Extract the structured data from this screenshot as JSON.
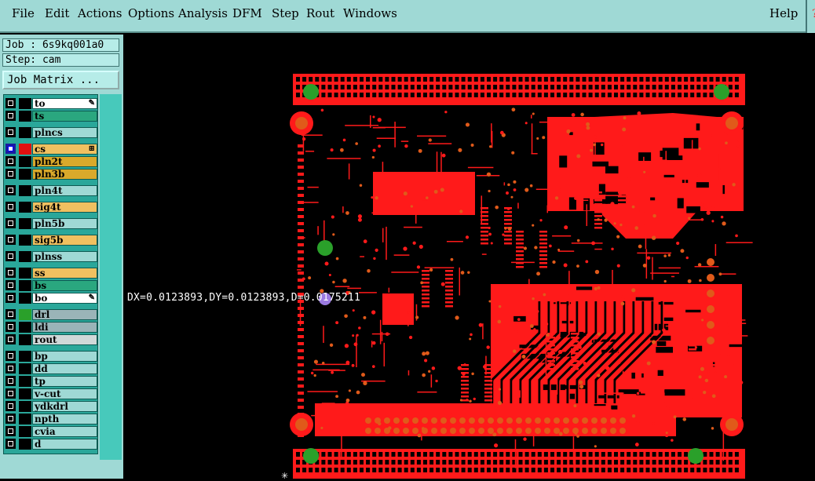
{
  "menu": {
    "items": [
      "File",
      "Edit",
      "Actions",
      "Options",
      "Analysis",
      "DFM",
      "Step",
      "Rout",
      "Windows"
    ],
    "help": "Help",
    "edge_glyph": "?"
  },
  "panel": {
    "job": "Job : 6s9kq001a0",
    "step": "Step: cam",
    "job_matrix": "Job Matrix ..."
  },
  "layers": [
    {
      "name": "to",
      "color": "#ffffff",
      "swatch": "#000000",
      "mark": "edit"
    },
    {
      "name": "ts",
      "color": "#2aa77f",
      "swatch": "#000000"
    },
    {
      "name": "plncs",
      "color": "#9fd9d5",
      "swatch": "#000000"
    },
    {
      "name": "cs",
      "color": "#f0c060",
      "swatch": "#e11010",
      "selected": true,
      "mark": "grid"
    },
    {
      "name": "pln2t",
      "color": "#d9a92b",
      "swatch": "#000000"
    },
    {
      "name": "pln3b",
      "color": "#d9a92b",
      "swatch": "#000000"
    },
    {
      "name": "pln4t",
      "color": "#9fd9d5",
      "swatch": "#000000"
    },
    {
      "name": "sig4t",
      "color": "#f0c060",
      "swatch": "#000000"
    },
    {
      "name": "pln5b",
      "color": "#9fd9d5",
      "swatch": "#000000"
    },
    {
      "name": "sig5b",
      "color": "#f0c060",
      "swatch": "#000000"
    },
    {
      "name": "plnss",
      "color": "#9fd9d5",
      "swatch": "#000000"
    },
    {
      "name": "ss",
      "color": "#f0c060",
      "swatch": "#000000"
    },
    {
      "name": "bs",
      "color": "#2aa77f",
      "swatch": "#000000"
    },
    {
      "name": "bo",
      "color": "#ffffff",
      "swatch": "#000000",
      "mark": "edit"
    },
    {
      "name": "drl",
      "color": "#9ab4b8",
      "swatch": "#2aa02a"
    },
    {
      "name": "ldi",
      "color": "#9ab4b8",
      "swatch": "#000000"
    },
    {
      "name": "rout",
      "color": "#d0d8d8",
      "swatch": "#000000"
    },
    {
      "name": "bp",
      "color": "#9fd9d5",
      "swatch": "#000000"
    },
    {
      "name": "dd",
      "color": "#9fd9d5",
      "swatch": "#000000"
    },
    {
      "name": "tp",
      "color": "#9fd9d5",
      "swatch": "#000000"
    },
    {
      "name": "v-cut",
      "color": "#9fd9d5",
      "swatch": "#000000"
    },
    {
      "name": "ydkdrl",
      "color": "#9fd9d5",
      "swatch": "#000000"
    },
    {
      "name": "npth",
      "color": "#9fd9d5",
      "swatch": "#000000"
    },
    {
      "name": "cvia",
      "color": "#9fd9d5",
      "swatch": "#000000"
    },
    {
      "name": "d",
      "color": "#9fd9d5",
      "swatch": "#000000"
    }
  ],
  "measure": {
    "readout": "DX=0.0123893,DY=0.0123893,D=0.0175211"
  },
  "colors": {
    "copper": "#ff1a1a",
    "pad": "#e05a1a",
    "drill": "#2aa02a",
    "background": "#000000",
    "panel": "#9fd9d5"
  }
}
